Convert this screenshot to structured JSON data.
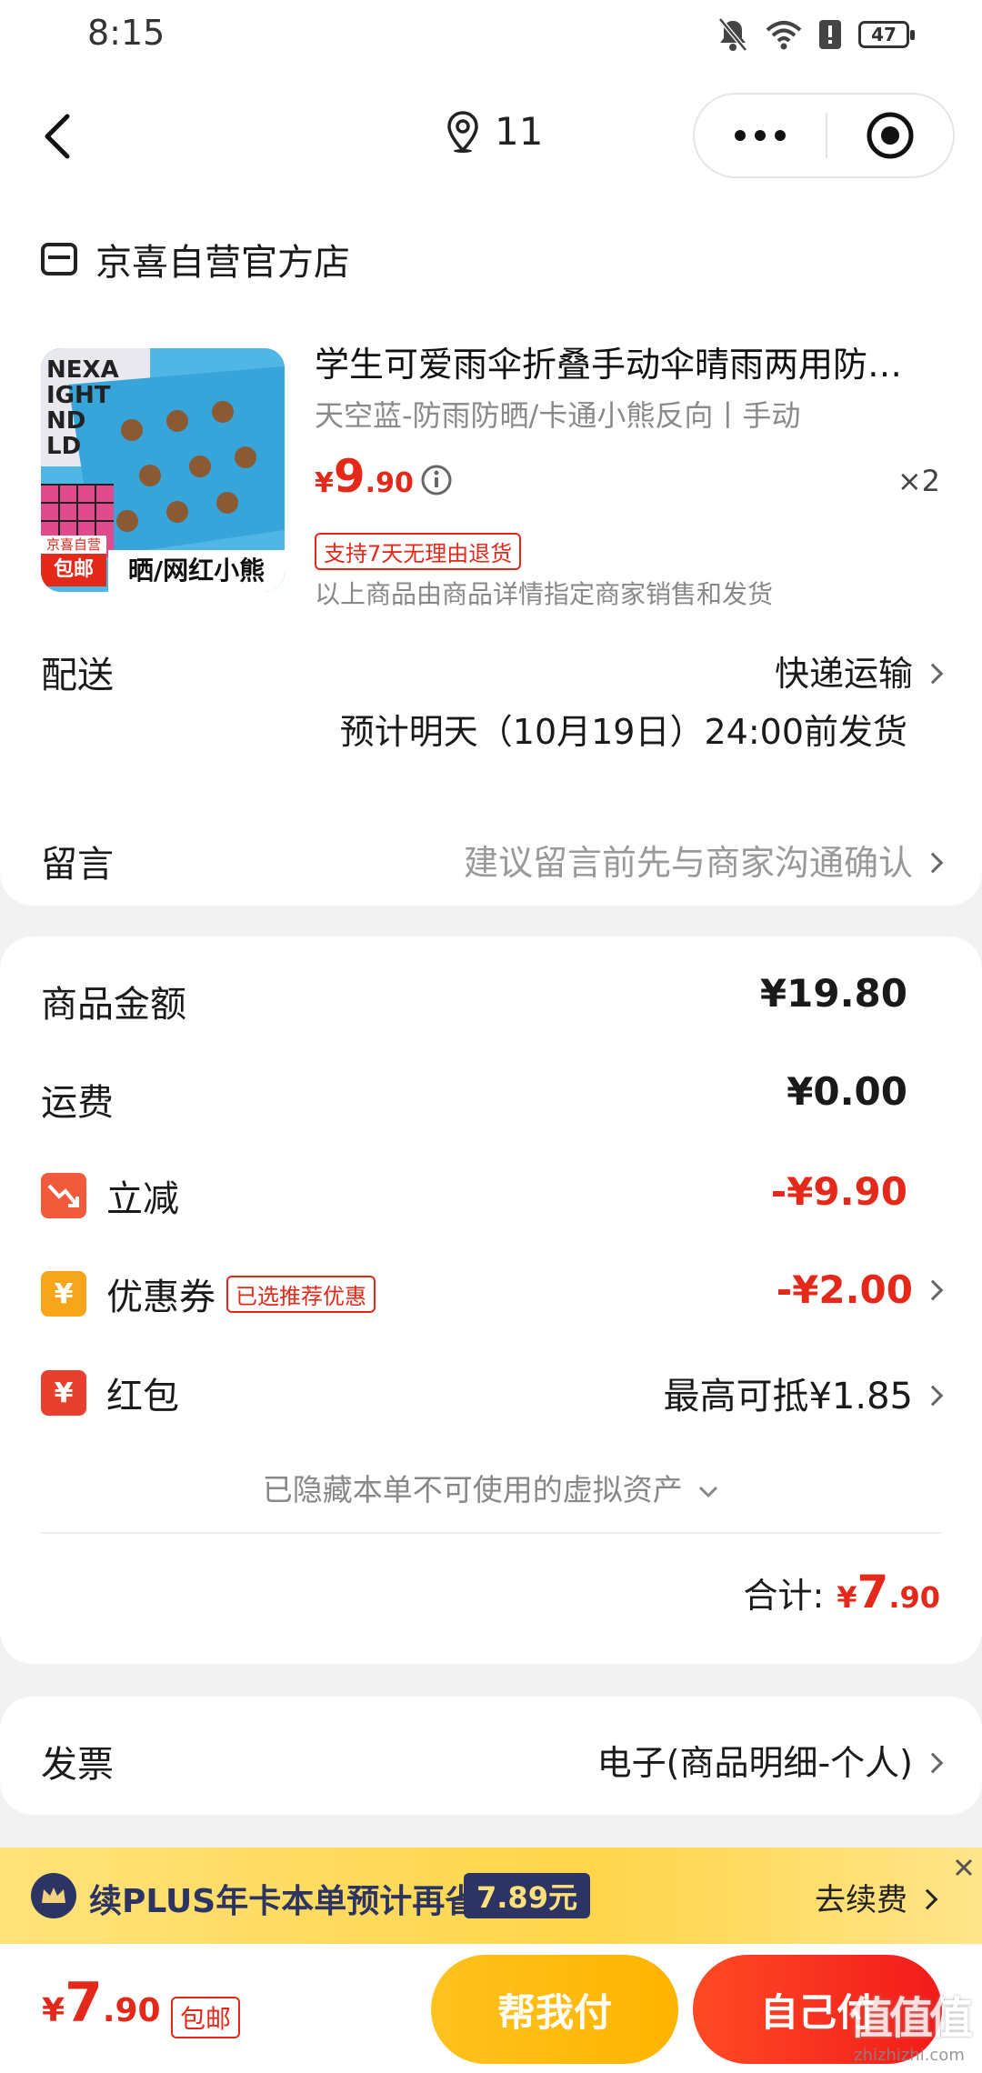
{
  "status": {
    "time": "8:15",
    "battery": "47"
  },
  "nav": {
    "location_count": "11"
  },
  "shop": {
    "name": "京喜自营官方店"
  },
  "product": {
    "title": "学生可爱雨伞折叠手动伞晴雨两用防…",
    "spec": "天空蓝-防雨防晒/卡通小熊反向丨手动",
    "price_symbol": "¥",
    "price_int": "9",
    "price_dec": ".90",
    "quantity": "×2",
    "return_tag": "支持7天无理由退货",
    "seller_note": "以上商品由商品详情指定商家销售和发货",
    "thumb_badge_top": "京喜自营",
    "thumb_badge_bottom": "包邮",
    "thumb_caption": "晒/网红小熊",
    "thumb_text": "NEXA\nIGHT\nND\nLD"
  },
  "delivery": {
    "label": "配送",
    "method": "快递运输",
    "eta": "预计明天（10月19日）24:00前发货"
  },
  "message": {
    "label": "留言",
    "placeholder": "建议留言前先与商家沟通确认"
  },
  "amounts": {
    "goods_label": "商品金额",
    "goods_value": "¥19.80",
    "shipping_label": "运费",
    "shipping_value": "¥0.00",
    "discount_label": "立减",
    "discount_value": "-¥9.90",
    "coupon_label": "优惠券",
    "coupon_tag": "已选推荐优惠",
    "coupon_value": "-¥2.00",
    "redpacket_label": "红包",
    "redpacket_value": "最高可抵¥1.85",
    "hidden_assets": "已隐藏本单不可使用的虚拟资产",
    "total_label": "合计:",
    "total_symbol": "¥",
    "total_int": "7",
    "total_dec": ".90"
  },
  "invoice": {
    "label": "发票",
    "value": "电子(商品明细-个人)"
  },
  "plus": {
    "text": "续PLUS年卡本单预计再省",
    "amount": "7.89元",
    "action": "去续费"
  },
  "bottom": {
    "price_symbol": "¥",
    "price_int": "7",
    "price_dec": ".90",
    "free_shipping": "包邮",
    "help_pay": "帮我付",
    "self_pay": "自己付"
  },
  "watermark": {
    "glyphs": "值值值",
    "url": "zhizhizhi.com"
  },
  "colors": {
    "accent_red": "#e4291a",
    "yellow": "#ffc222",
    "plus_navy": "#2b3463"
  }
}
